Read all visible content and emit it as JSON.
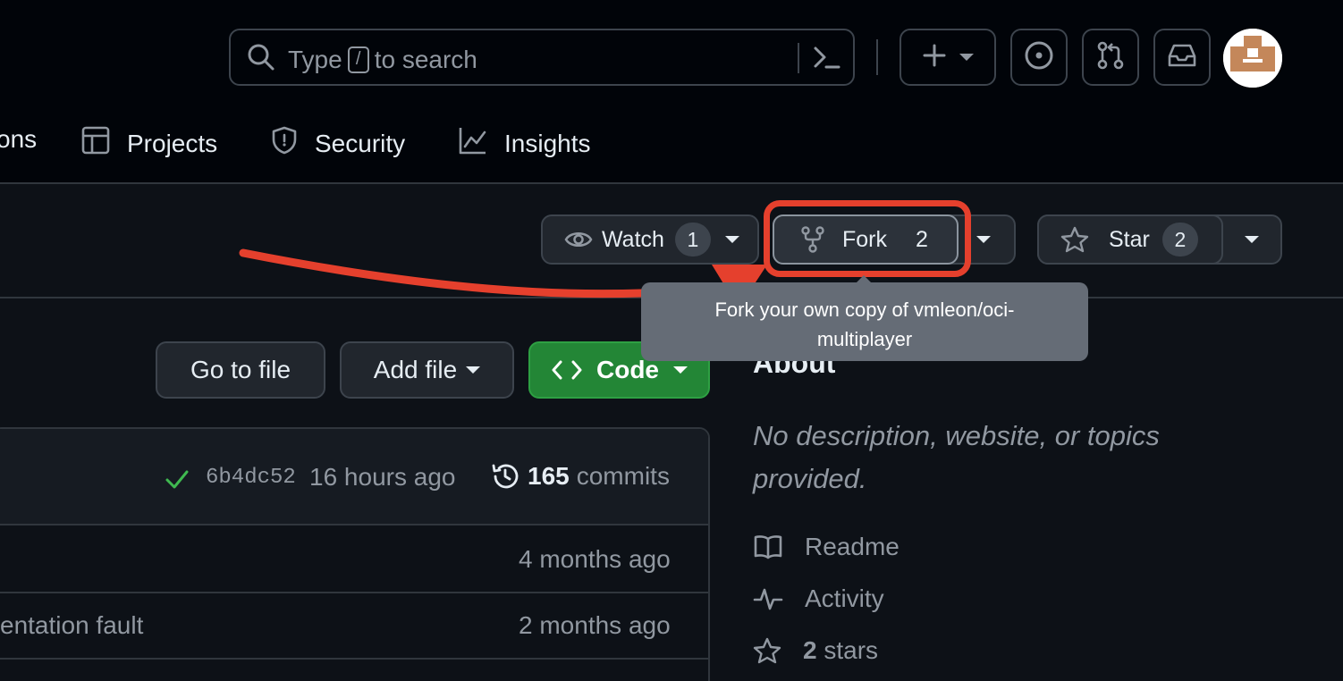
{
  "header": {
    "search": {
      "prefix": "Type",
      "slash": "/",
      "suffix": "to search"
    },
    "avatar_colors": [
      "#c4875a",
      "#ffffff"
    ]
  },
  "nav": {
    "partial_tab": "ons",
    "tabs": [
      {
        "label": "Projects",
        "icon": "table-icon"
      },
      {
        "label": "Security",
        "icon": "shield-icon"
      },
      {
        "label": "Insights",
        "icon": "graph-icon"
      }
    ]
  },
  "repo_actions": {
    "watch": {
      "label": "Watch",
      "count": "1"
    },
    "fork": {
      "label": "Fork",
      "count": "2"
    },
    "star": {
      "label": "Star",
      "count": "2"
    }
  },
  "tooltip": {
    "text": "Fork your own copy of vmleon/oci-multiplayer"
  },
  "annotation": {
    "highlight_color": "#e5402d"
  },
  "file_toolbar": {
    "go_to_file": "Go to file",
    "add_file": "Add file",
    "code": "Code"
  },
  "commit_bar": {
    "hash": "6b4dc52",
    "time": "16 hours ago",
    "commits_count": "165",
    "commits_label": "commits"
  },
  "file_rows": [
    {
      "message": "",
      "time": "4 months ago"
    },
    {
      "message": "entation fault",
      "time": "2 months ago"
    }
  ],
  "about": {
    "title": "About",
    "description": "No description, website, or topics provided.",
    "items": [
      {
        "label": "Readme",
        "icon": "book-icon"
      },
      {
        "label": "Activity",
        "icon": "pulse-icon"
      },
      {
        "count": "2",
        "label": "stars",
        "icon": "star-icon"
      }
    ]
  },
  "colors": {
    "background": "#0d1117",
    "header_bg": "#010409",
    "primary_green": "#238636",
    "tooltip_bg": "#656c76",
    "check_green": "#3fb950"
  }
}
